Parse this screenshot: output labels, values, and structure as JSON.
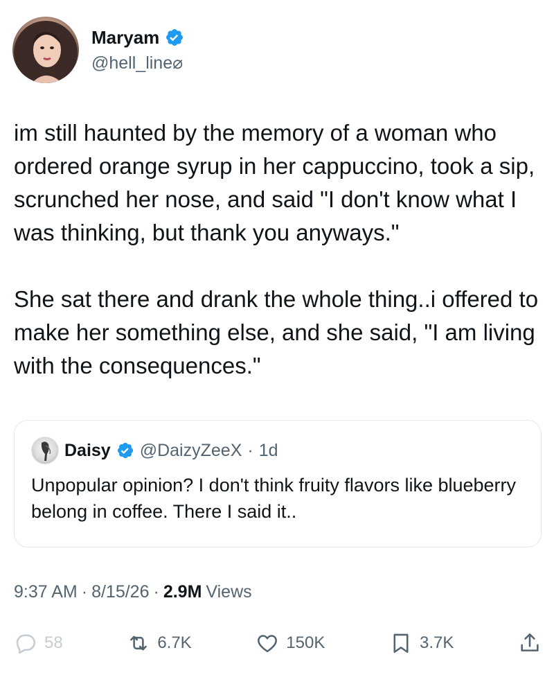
{
  "author": {
    "name": "Maryam",
    "handle": "@hell_line⌀"
  },
  "tweet": {
    "text": "im still haunted by the memory of a woman who ordered orange syrup in her cappuccino, took a sip, scrunched her nose, and said \"I don't know what I was thinking, but thank you anyways.\"\n\nShe sat there and drank the whole thing..i offered to make her something else, and she said, \"I am living with the consequences.\""
  },
  "quote": {
    "name": "Daisy",
    "handle": "@DaizyZeeX",
    "separator": "·",
    "age": "1d",
    "text": "Unpopular opinion? I don't think fruity flavors like blueberry belong in coffee. There I said it.."
  },
  "meta": {
    "time": "9:37 AM",
    "sep1": "·",
    "date": "8/15/26",
    "sep2": "·",
    "views_count": "2.9M",
    "views_label": "Views"
  },
  "actions": {
    "replies": "58",
    "reposts": "6.7K",
    "likes": "150K",
    "bookmarks": "3.7K"
  },
  "colors": {
    "verified": "#1d9bf0",
    "text": "#0f1419",
    "muted": "#536471",
    "border": "#e1e8ed"
  }
}
